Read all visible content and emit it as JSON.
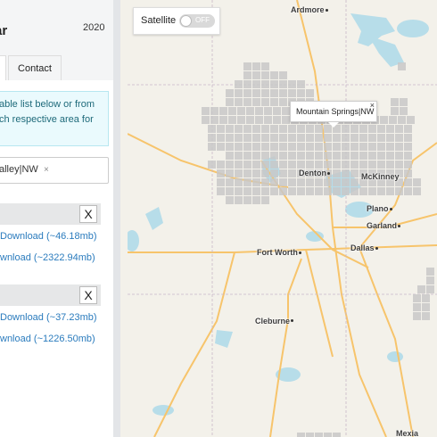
{
  "sidebar": {
    "title_fragment": "ar",
    "year": "2020",
    "tabs": [
      {
        "label": ""
      },
      {
        "label": "Contact"
      }
    ],
    "info_lines": [
      "able list below or from",
      "ch respective area for"
    ],
    "selected_tag": "alley|NW",
    "selected_tag_remove": "×",
    "panels": [
      {
        "close": "X",
        "links": [
          "Download (~46.18mb)",
          "wnload (~2322.94mb)"
        ]
      },
      {
        "close": "X",
        "links": [
          "Download (~37.23mb)",
          "wnload (~1226.50mb)"
        ]
      }
    ]
  },
  "map": {
    "satellite_label": "Satellite",
    "satellite_state": "OFF",
    "popup": {
      "text": "Mountain Springs|NW",
      "close": "×"
    },
    "places": [
      "Ardmore",
      "Denton",
      "McKinney",
      "Plano",
      "Garland",
      "Fort Worth",
      "Dallas",
      "Cleburne",
      "Mexia"
    ],
    "colors": {
      "land": "#f3f1ea",
      "water": "#b7dde9",
      "tile": "#c8c8c8",
      "tile_selected": "#7d7d7d",
      "highway": "#f7c46b",
      "county_line": "#c9b7c9"
    }
  }
}
